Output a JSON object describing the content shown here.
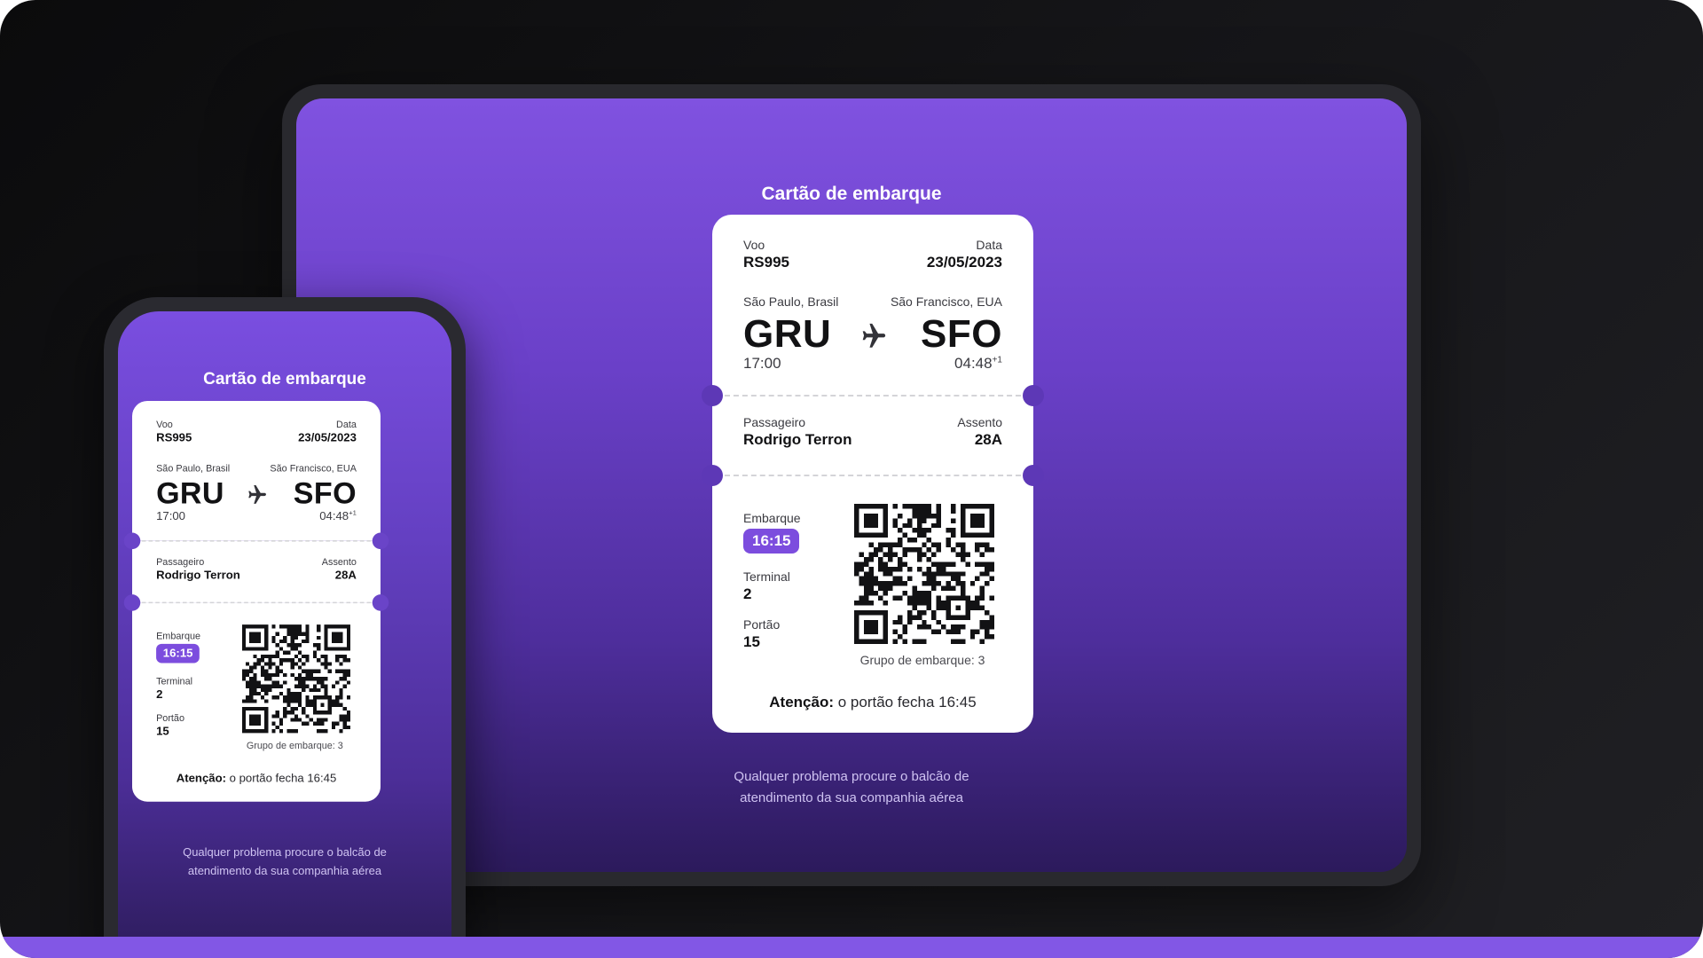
{
  "screen_title": "Cartão de embarque",
  "flight": {
    "label": "Voo",
    "value": "RS995"
  },
  "date": {
    "label": "Data",
    "value": "23/05/2023"
  },
  "origin": {
    "city": "São Paulo, Brasil",
    "code": "GRU",
    "time": "17:00"
  },
  "destination": {
    "city": "São Francisco, EUA",
    "code": "SFO",
    "time": "04:48",
    "day_offset": "+1"
  },
  "passenger": {
    "label": "Passageiro",
    "value": "Rodrigo Terron"
  },
  "seat": {
    "label": "Assento",
    "value": "28A"
  },
  "boarding": {
    "label": "Embarque",
    "value": "16:15"
  },
  "terminal": {
    "label": "Terminal",
    "value": "2"
  },
  "gate": {
    "label": "Portão",
    "value": "15"
  },
  "group_text": "Grupo de embarque: 3",
  "attention": {
    "prefix": "Atenção:",
    "text": " o portão fecha 16:45"
  },
  "footnote": {
    "line1": "Qualquer problema procure o balcão de",
    "line2": "atendimento da sua companhia aérea"
  },
  "icons": {
    "plane": "airplane-icon",
    "qr": "qr-code-icon"
  },
  "colors": {
    "accent": "#8257e5",
    "badge": "#7c4dde",
    "background": "#121214"
  }
}
